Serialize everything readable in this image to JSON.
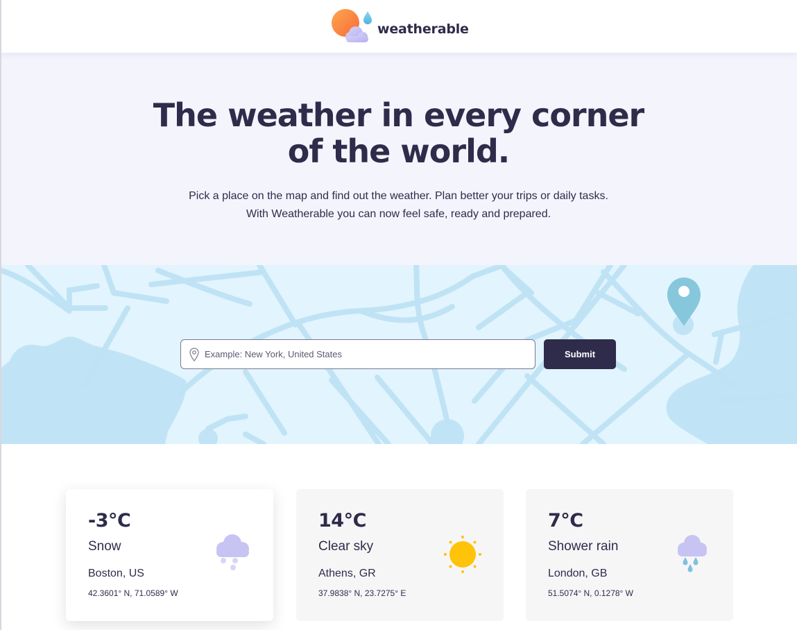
{
  "brand": {
    "name": "weatherable",
    "logo_icon": "sun-cloud-droplet-logo"
  },
  "hero": {
    "title_lines": [
      "The weather in every corner",
      "of the world."
    ],
    "subtitle_lines": [
      "Pick a place on the map and find out the weather. Plan better your trips or daily tasks.",
      "With Weatherable you can now feel safe, ready and prepared."
    ]
  },
  "search": {
    "placeholder": "Example: New York, United States",
    "value": "",
    "icon": "location-pin-icon",
    "submit_label": "Submit"
  },
  "cards": [
    {
      "temp": "-3°C",
      "condition": "Snow",
      "city": "Boston, US",
      "coords": "42.3601° N, 71.0589° W",
      "icon": "snow-cloud-icon",
      "selected": true
    },
    {
      "temp": "14°C",
      "condition": "Clear sky",
      "city": "Athens, GR",
      "coords": "37.9838° N, 23.7275° E",
      "icon": "sun-icon",
      "selected": false
    },
    {
      "temp": "7°C",
      "condition": "Shower rain",
      "city": "London, GB",
      "coords": "51.5074° N, 0.1278° W",
      "icon": "rain-cloud-icon",
      "selected": false
    }
  ],
  "colors": {
    "primary": "#2e2c4a",
    "hero_bg": "#f4f4fd",
    "map_bg": "#e2f4fd",
    "map_roads": "#bfe3f5",
    "sun": "#ffc30a",
    "cloud": "#c7c4f3",
    "rain": "#7ec1e0"
  }
}
